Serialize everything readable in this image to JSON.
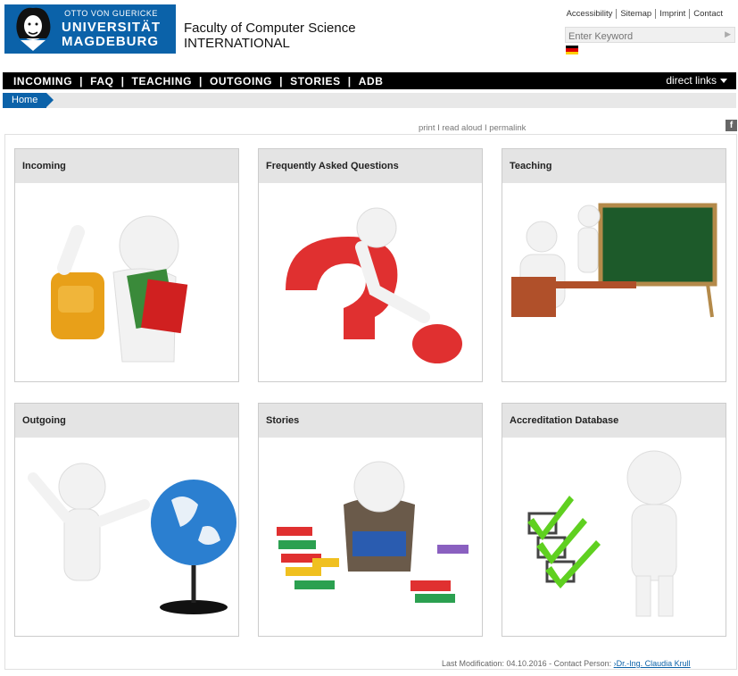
{
  "header": {
    "logo_line1": "OTTO VON GUERICKE",
    "logo_line2": "UNIVERSITÄT",
    "logo_line3": "MAGDEBURG",
    "faculty_name": "Faculty of Computer Science",
    "faculty_sub": "INTERNATIONAL"
  },
  "top_links": [
    "Accessibility",
    "Sitemap",
    "Imprint",
    "Contact"
  ],
  "search": {
    "placeholder": "Enter Keyword"
  },
  "language": {
    "flag": "german-flag-icon",
    "colors": [
      "#000000",
      "#dd0000",
      "#ffce00"
    ]
  },
  "nav": {
    "items": [
      "INCOMING",
      "FAQ",
      "TEACHING",
      "OUTGOING",
      "STORIES",
      "ADB"
    ],
    "direct_links": "direct links"
  },
  "breadcrumb": {
    "home": "Home"
  },
  "page_tools": {
    "print": "print",
    "read_aloud": "read aloud",
    "permalink": "permalink",
    "separator": "I"
  },
  "social": {
    "facebook": "f"
  },
  "cards": [
    {
      "title": "Incoming",
      "image": "student-with-backpack-image"
    },
    {
      "title": "Frequently Asked Questions",
      "image": "question-mark-figure-image"
    },
    {
      "title": "Teaching",
      "image": "teacher-at-blackboard-image"
    },
    {
      "title": "Outgoing",
      "image": "figure-with-globe-image"
    },
    {
      "title": "Stories",
      "image": "reading-among-books-image"
    },
    {
      "title": "Accreditation Database",
      "image": "checkmarks-figure-image"
    }
  ],
  "footer": {
    "modified_label": "Last Modification: 04.10.2016 - Contact Person:",
    "contact_link": "Dr.-Ing. Claudia Krull"
  },
  "colors": {
    "brand_blue": "#0b62a9",
    "nav_black": "#000000",
    "card_header_gray": "#e4e4e4"
  }
}
